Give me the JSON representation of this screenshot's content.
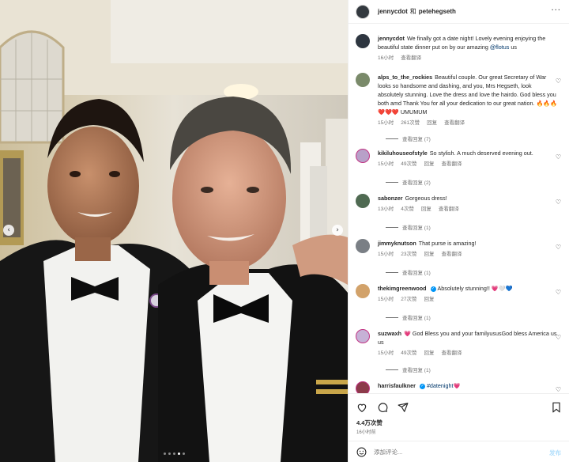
{
  "header": {
    "user1": "jennycdot",
    "separator": "和",
    "user2": "petehegseth"
  },
  "caption": {
    "username": "jennycdot",
    "text": "We finally got a date night! Lovely evening enjoying the beautiful state dinner put on by our amazing",
    "mention": "@flotus",
    "suffix": "us",
    "time": "16小时",
    "translate": "查看翻译"
  },
  "comments": [
    {
      "username": "alps_to_the_rockies",
      "text": "Beautiful couple. Our great Secretary of War looks so handsome and dashing, and you, Mrs Hegseth, look absolutely stunning. Love the dress and love the hairdo. God bless you both amd Thank You for all your dedication to our great nation. 🔥🔥🔥❤️❤️❤️ UMUMUM",
      "time": "15小时",
      "likes": "261次赞",
      "reply": "回复",
      "translate": "查看翻译",
      "replies": "查看回复 (7)"
    },
    {
      "username": "kikiluhouseofstyle",
      "text": "So stylish. A much deserved evening out.",
      "time": "15小时",
      "likes": "49次赞",
      "reply": "回复",
      "translate": "查看翻译",
      "replies": "查看回复 (2)"
    },
    {
      "username": "sabonzer",
      "text": "Gorgeous dress!",
      "time": "13小时",
      "likes": "4次赞",
      "reply": "回复",
      "translate": "查看翻译",
      "replies": "查看回复 (1)"
    },
    {
      "username": "jimmyknutson",
      "text": "That purse is amazing!",
      "time": "15小时",
      "likes": "23次赞",
      "reply": "回复",
      "translate": "查看翻译",
      "replies": "查看回复 (1)"
    },
    {
      "username": "thekimgreenwood",
      "text": "Absolutely stunning!! 💗🤍💙",
      "time": "15小时",
      "likes": "27次赞",
      "reply": "回复",
      "translate": "",
      "replies": "查看回复 (1)"
    },
    {
      "username": "suzwaxh",
      "text": "💗 God Bless you and your familyususGod bless America us us",
      "time": "15小时",
      "likes": "49次赞",
      "reply": "回复",
      "translate": "查看翻译",
      "replies": "查看回复 (1)"
    },
    {
      "username": "harrisfaulkner",
      "text": "#datenight💗",
      "time": "",
      "likes": "",
      "reply": "",
      "translate": "",
      "replies": ""
    }
  ],
  "stats": {
    "likes": "4.4万次赞",
    "time": "16小时前"
  },
  "add_comment": {
    "placeholder": "添加评论...",
    "post": "发布"
  },
  "icons": [
    "more-icon",
    "heart-icon",
    "comment-icon",
    "share-icon",
    "bookmark-icon",
    "emoji-icon",
    "chevron-left-icon",
    "chevron-right-icon"
  ],
  "colors": {
    "link": "#00376b",
    "verified": "#0095f6",
    "muted": "#737373",
    "post_disabled": "#b2dffc"
  },
  "carousel": {
    "total": 5,
    "active": 3
  }
}
